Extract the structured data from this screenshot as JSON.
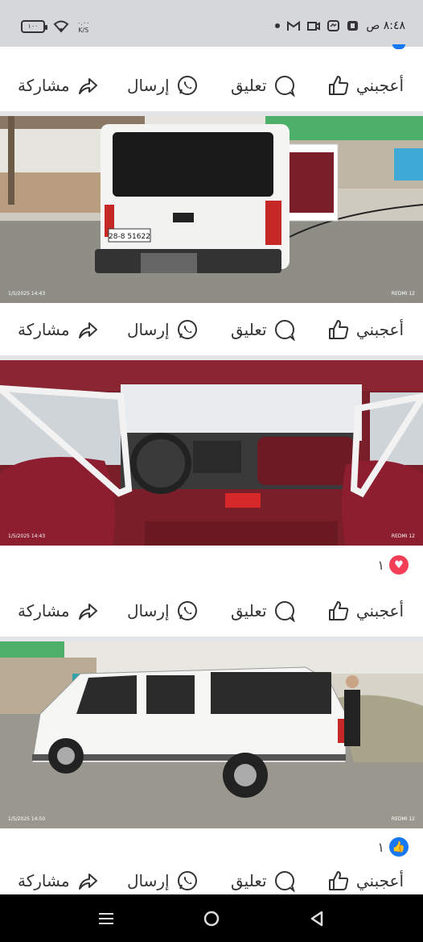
{
  "status_bar": {
    "time": "٨:٤٨ ص",
    "battery": "١٠٠",
    "net_speed_top": "٠.٠٠",
    "net_speed_bottom": "K/S"
  },
  "actions": {
    "like": "أعجبني",
    "comment": "تعليق",
    "send": "إرسال",
    "share": "مشاركة"
  },
  "photos": [
    {
      "date": "1/5/2025 14:43",
      "camera": "REDMI 12",
      "plate": "28-8 51622"
    },
    {
      "date": "1/5/2025 14:43",
      "camera": "REDMI 12"
    },
    {
      "date": "1/5/2025 14:50",
      "camera": "REDMI 12"
    }
  ],
  "reactions": [
    {
      "type": "love",
      "count": "١",
      "color": "#f33e58"
    },
    {
      "type": "like",
      "count": "١",
      "color": "#1877f2"
    }
  ],
  "colors": {
    "accent": "#1877f2",
    "love": "#f33e58",
    "separator": "#e3e4e8"
  }
}
